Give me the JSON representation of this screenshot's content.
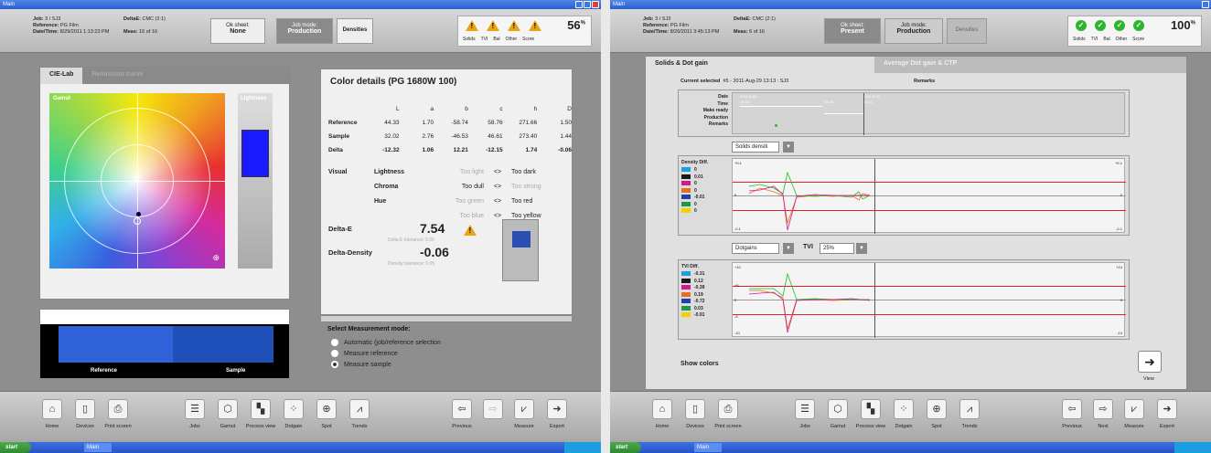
{
  "left": {
    "title": "Main",
    "info": {
      "job_label": "Job:",
      "job": "3 / SJ3",
      "ref_label": "Reference:",
      "ref": "PG Film",
      "dt_label": "Date/Time:",
      "dt": "8/29/2011 1:13:23 PM",
      "deltae_label": "DeltaE:",
      "deltae": "CMC (2:1)",
      "meas_label": "Meas:",
      "meas": "16 of 16"
    },
    "ok_sheet": {
      "label": "Ok sheet:",
      "value": "None"
    },
    "job_mode": {
      "label": "Job mode:",
      "value": "Production"
    },
    "densities": "Densities",
    "status_labels": [
      "Solids",
      "TVI",
      "Bal",
      "Other",
      "Score"
    ],
    "score": "56",
    "score_unit": "%",
    "tabs": [
      "CIE-Lab",
      "Remission curve"
    ],
    "gamut_label": "Gamut",
    "lightness_label": "Lightness",
    "color_details_title": "Color details (PG 1680W 100)",
    "cd_headers": [
      "",
      "L",
      "a",
      "b",
      "c",
      "h",
      "D"
    ],
    "cd_rows": [
      [
        "Reference",
        "44.33",
        "1.70",
        "-58.74",
        "58.76",
        "271.66",
        "1.50"
      ],
      [
        "Sample",
        "32.02",
        "2.76",
        "-46.53",
        "46.61",
        "273.40",
        "1.44"
      ],
      [
        "Delta",
        "-12.32",
        "1.06",
        "12.21",
        "-12.15",
        "1.74",
        "-0.06"
      ]
    ],
    "visual_label": "Visual",
    "visual": [
      [
        "Lightness",
        "Too light",
        "<>",
        "Too dark"
      ],
      [
        "Chroma",
        "Too dull",
        "<>",
        "Too strong"
      ],
      [
        "Hue",
        "Too green",
        "<>",
        "Too red"
      ],
      [
        "",
        "Too blue",
        "<>",
        "Too yellow"
      ]
    ],
    "deltae_title": "Delta-E",
    "deltae_value": "7.54",
    "deltae_tol": "Delta E tolerance: 5.00",
    "deltad_title": "Delta-Density",
    "deltad_value": "-0.06",
    "deltad_tol": "Density tolerance: 0.05",
    "ref_label": "Reference",
    "sample_label": "Sample",
    "meas_mode_title": "Select Measurement mode:",
    "meas_modes": [
      "Automatic (job/reference selection",
      "Measure reference",
      "Measure sample"
    ],
    "toolbar": [
      "Home",
      "Devices",
      "Print screen",
      "Jobs",
      "Gamut",
      "Process view",
      "Dotgain",
      "Spot",
      "Trends",
      "Previous",
      "Next",
      "Measure",
      "Export"
    ],
    "start": "start",
    "task_item": "Main"
  },
  "right": {
    "title": "Main",
    "info": {
      "job": "3 / SJ3",
      "ref": "PG Film",
      "dt": "8/26/2011 3:45:13 PM",
      "deltae": "CMC (2:1)",
      "meas": "6 of 16"
    },
    "ok_sheet": {
      "label": "Ok sheet:",
      "value": "Present"
    },
    "job_mode": {
      "label": "Job mode:",
      "value": "Production"
    },
    "densities": "Densities",
    "score": "100",
    "tabs": [
      "Solids & Dot gain",
      "Average Dot gain & CTP"
    ],
    "current_selected_label": "Current selected",
    "current_selected": "#5 - 2011-Aug-29 13:13 : SJ3",
    "remarks": "Remarks",
    "timeline_rows": [
      "Date",
      "Time",
      "Make ready",
      "Production",
      "Remarks"
    ],
    "timeline_dates": [
      "2011-8-26",
      "2011-8-29"
    ],
    "timeline_times": [
      "15:45",
      "15:46",
      "13:13"
    ],
    "solids_select": "Solids densiti",
    "density_title": "Density Diff.",
    "density_values": [
      "0",
      "0.01",
      "0",
      "0",
      "-0.01",
      "0",
      "0"
    ],
    "density_axis": [
      "+0.1",
      "0",
      "-0.1"
    ],
    "dotgains_select": "Dotgains",
    "tvi_label": "TVI",
    "tvi_value": "25%",
    "tvi_title": "TVI Diff.",
    "tvi_values": [
      "-0.31",
      "0.12",
      "-0.39",
      "0.19",
      "-0.72",
      "0.03",
      "-0.01"
    ],
    "tvi_axis": [
      "+10",
      "+5",
      "0",
      "-5",
      "-10"
    ],
    "show_colors": "Show colors",
    "view": "View",
    "colors": {
      "cyan": "#1aa0e0",
      "black": "#1a1a1a",
      "magenta": "#d01890",
      "orange": "#e8701a",
      "blue": "#2040b0",
      "green": "#1a9a40",
      "yellow": "#f0d000"
    }
  }
}
